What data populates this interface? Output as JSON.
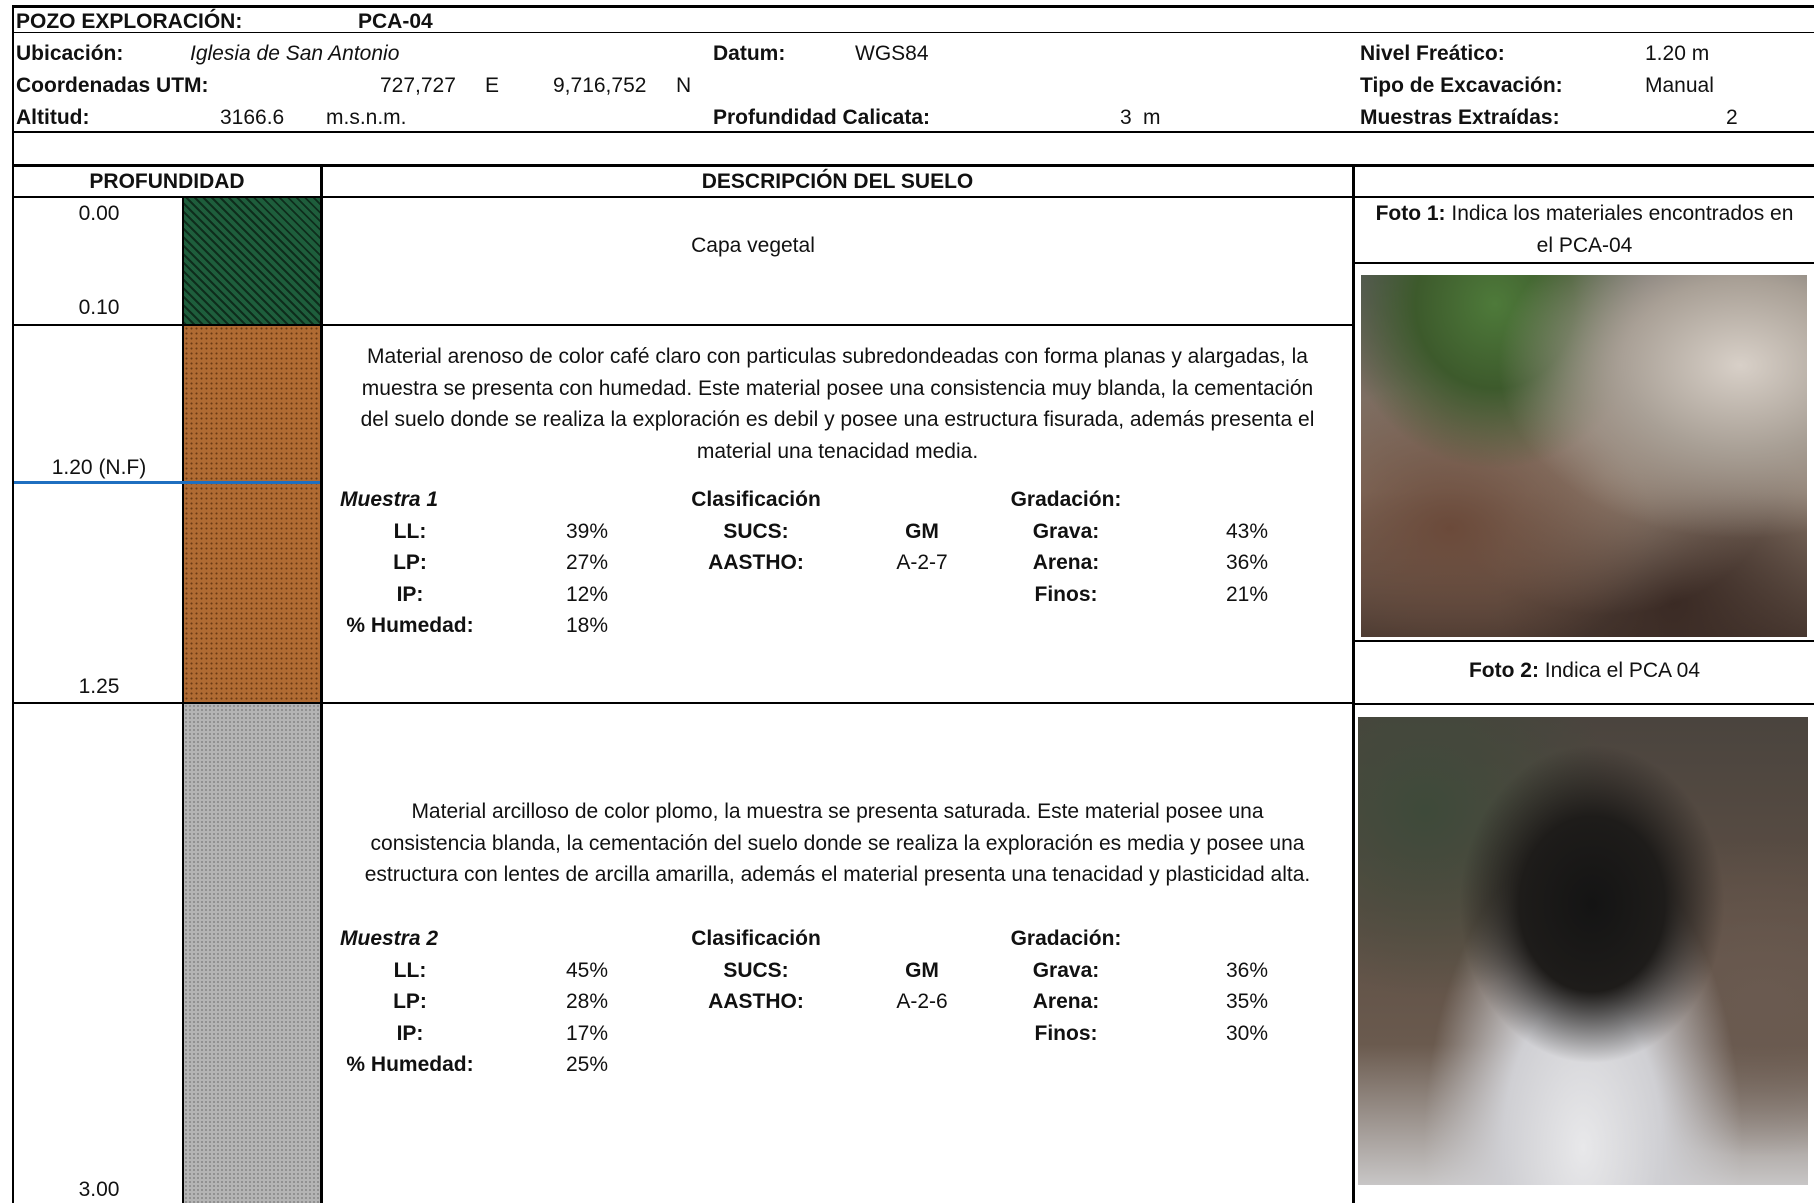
{
  "header": {
    "pozo_label": "POZO EXPLORACIÓN:",
    "pozo_value": "PCA-04",
    "ubicacion_label": "Ubicación:",
    "ubicacion_value": "Iglesia de San Antonio",
    "datum_label": "Datum:",
    "datum_value": "WGS84",
    "nivel_label": "Nivel Freático:",
    "nivel_value": "1.20 m",
    "coord_label": "Coordenadas UTM:",
    "coord_e_value": "727,727",
    "coord_e_unit": "E",
    "coord_n_value": "9,716,752",
    "coord_n_unit": "N",
    "tipo_label": "Tipo de Excavación:",
    "tipo_value": "Manual",
    "altitud_label": "Altitud:",
    "altitud_value": "3166.6",
    "altitud_unit": "m.s.n.m.",
    "profundidad_label": "Profundidad Calicata:",
    "profundidad_value": "3",
    "profundidad_unit": "m",
    "muestras_label": "Muestras Extraídas:",
    "muestras_value": "2"
  },
  "columns": {
    "profundidad": "PROFUNDIDAD",
    "descripcion": "DESCRIPCIÓN DEL SUELO"
  },
  "depths": {
    "d0": "0.00",
    "d1": "0.10",
    "nf": "1.20 (N.F)",
    "d2": "1.25",
    "d3": "3.00"
  },
  "layer1": {
    "description": "Capa vegetal"
  },
  "layer2": {
    "description_lines": [
      "Material arenoso de color café claro  con particulas subredondeadas con forma planas y alargadas, la",
      "muestra se presenta con humedad. Este material posee una consistencia muy blanda, la cementación",
      "del suelo donde se realiza la exploración es debil y posee una estructura fisurada, además presenta el",
      "material una tenacidad media."
    ],
    "sample_title": "Muestra 1",
    "ll_label": "LL:",
    "ll_value": "39%",
    "lp_label": "LP:",
    "lp_value": "27%",
    "ip_label": "IP:",
    "ip_value": "12%",
    "hum_label": "% Humedad:",
    "hum_value": "18%",
    "clas_title": "Clasificación",
    "sucs_label": "SUCS:",
    "sucs_value": "GM",
    "aastho_label": "AASTHO:",
    "aastho_value": "A-2-7",
    "grad_title": "Gradación:",
    "grava_label": "Grava:",
    "grava_value": "43%",
    "arena_label": "Arena:",
    "arena_value": "36%",
    "finos_label": "Finos:",
    "finos_value": "21%"
  },
  "layer3": {
    "description_lines": [
      "Material arcilloso de color plomo, la muestra se presenta saturada. Este material posee una",
      "consistencia blanda, la cementación del suelo donde se realiza la exploración es media y posee una",
      "estructura con lentes de arcilla amarilla, además el material presenta una tenacidad y plasticidad alta."
    ],
    "sample_title": "Muestra 2",
    "ll_label": "LL:",
    "ll_value": "45%",
    "lp_label": "LP:",
    "lp_value": "28%",
    "ip_label": "IP:",
    "ip_value": "17%",
    "hum_label": "% Humedad:",
    "hum_value": "25%",
    "clas_title": "Clasificación",
    "sucs_label": "SUCS:",
    "sucs_value": "GM",
    "aastho_label": "AASTHO:",
    "aastho_value": "A-2-6",
    "grad_title": "Gradación:",
    "grava_label": "Grava:",
    "grava_value": "36%",
    "arena_label": "Arena:",
    "arena_value": "35%",
    "finos_label": "Finos:",
    "finos_value": "30%"
  },
  "photos": {
    "foto1_label": "Foto 1:",
    "foto1_text_line1": " Indica los materiales encontrados en",
    "foto1_text_line2": "el PCA-04",
    "foto2_label": "Foto 2:",
    "foto2_text": " Indica el PCA 04"
  },
  "colors": {
    "vegetal": "#1e5e3c",
    "arenoso": "#b06b33",
    "arcilloso": "#b4b4b4",
    "nivel_freatico_line": "#1f6fc0"
  }
}
